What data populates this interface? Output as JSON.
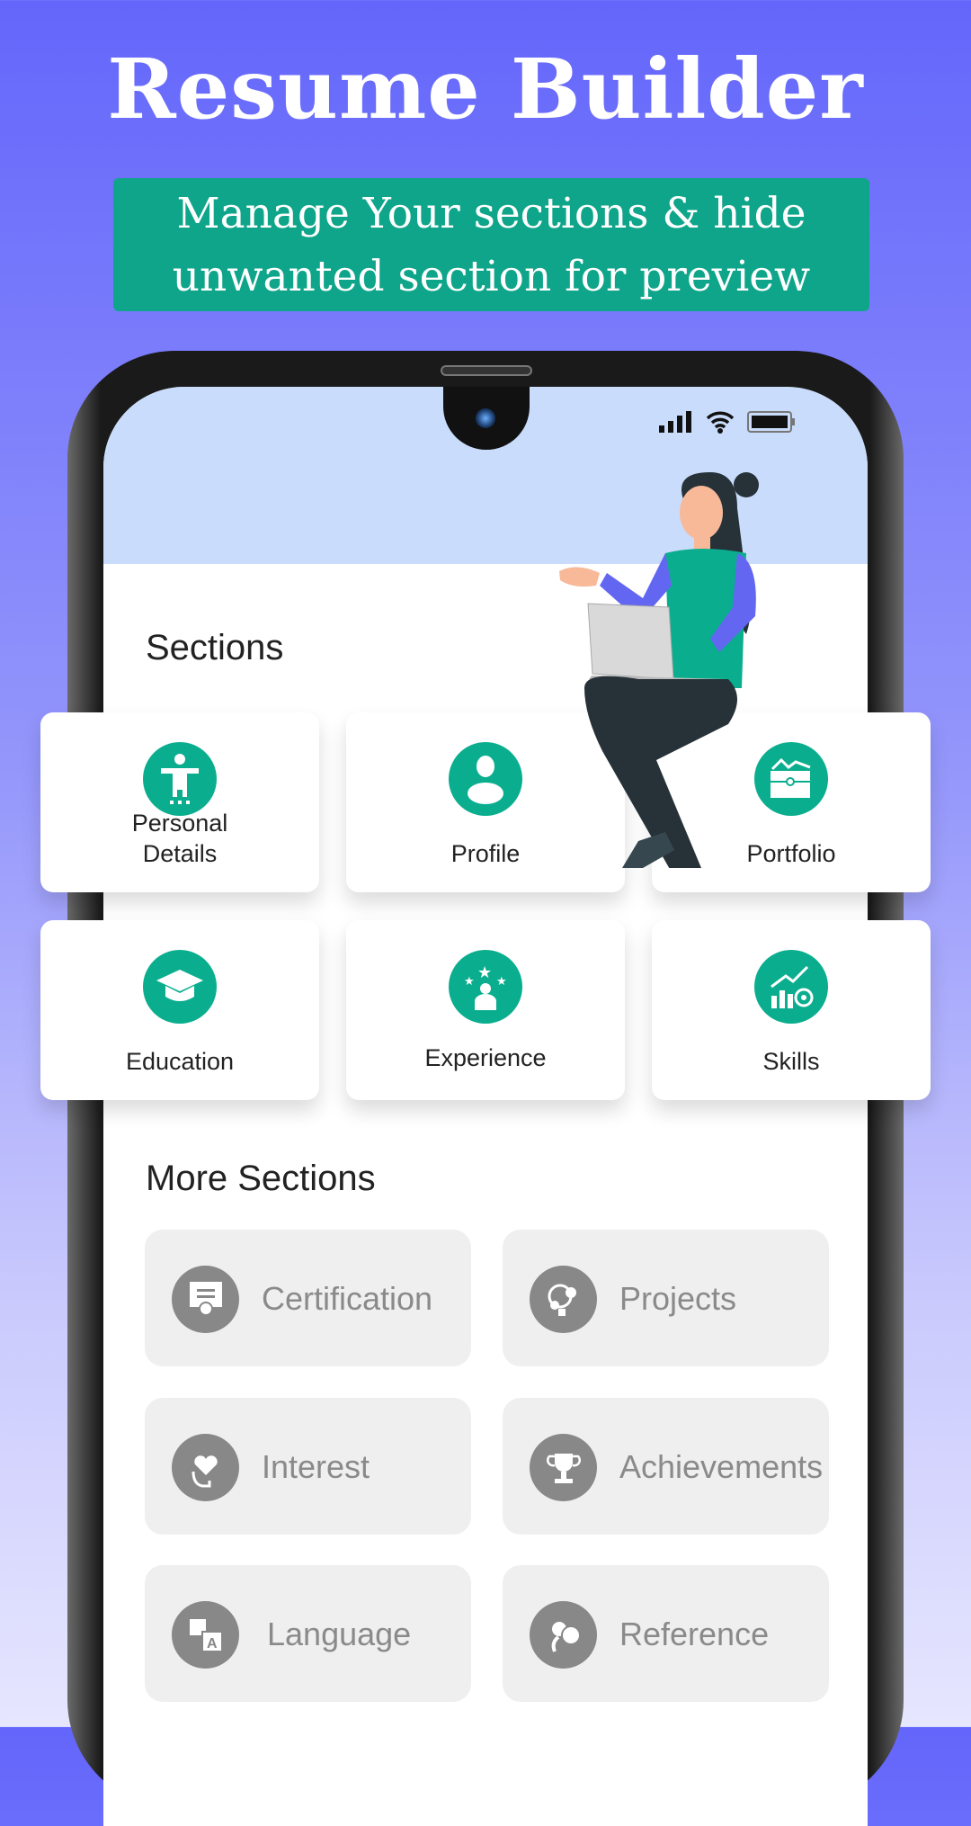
{
  "hero": {
    "title": "Resume Builder",
    "subtitle": "Manage Your sections & hide\nunwanted section for preview"
  },
  "colors": {
    "accent": "#0aae8e",
    "banner": "#0fa58a",
    "header": "#c9dcfb",
    "disabled": "#888888"
  },
  "sections": {
    "title": "Sections",
    "items": [
      {
        "label": "Personal Details",
        "icon": "accessibility-icon"
      },
      {
        "label": "Profile",
        "icon": "user-icon"
      },
      {
        "label": "Portfolio",
        "icon": "wallet-icon"
      },
      {
        "label": "Education",
        "icon": "graduation-cap-icon"
      },
      {
        "label": "Experience",
        "icon": "stars-person-icon"
      },
      {
        "label": "Skills",
        "icon": "chart-target-icon"
      }
    ]
  },
  "more_sections": {
    "title": "More Sections",
    "items": [
      {
        "label": "Certification",
        "icon": "certificate-icon"
      },
      {
        "label": "Projects",
        "icon": "lightbulb-gears-icon"
      },
      {
        "label": "Interest",
        "icon": "head-heart-icon"
      },
      {
        "label": "Achievements",
        "icon": "trophy-icon"
      },
      {
        "label": "Language",
        "icon": "translate-icon"
      },
      {
        "label": "Reference",
        "icon": "reference-icon"
      }
    ]
  }
}
